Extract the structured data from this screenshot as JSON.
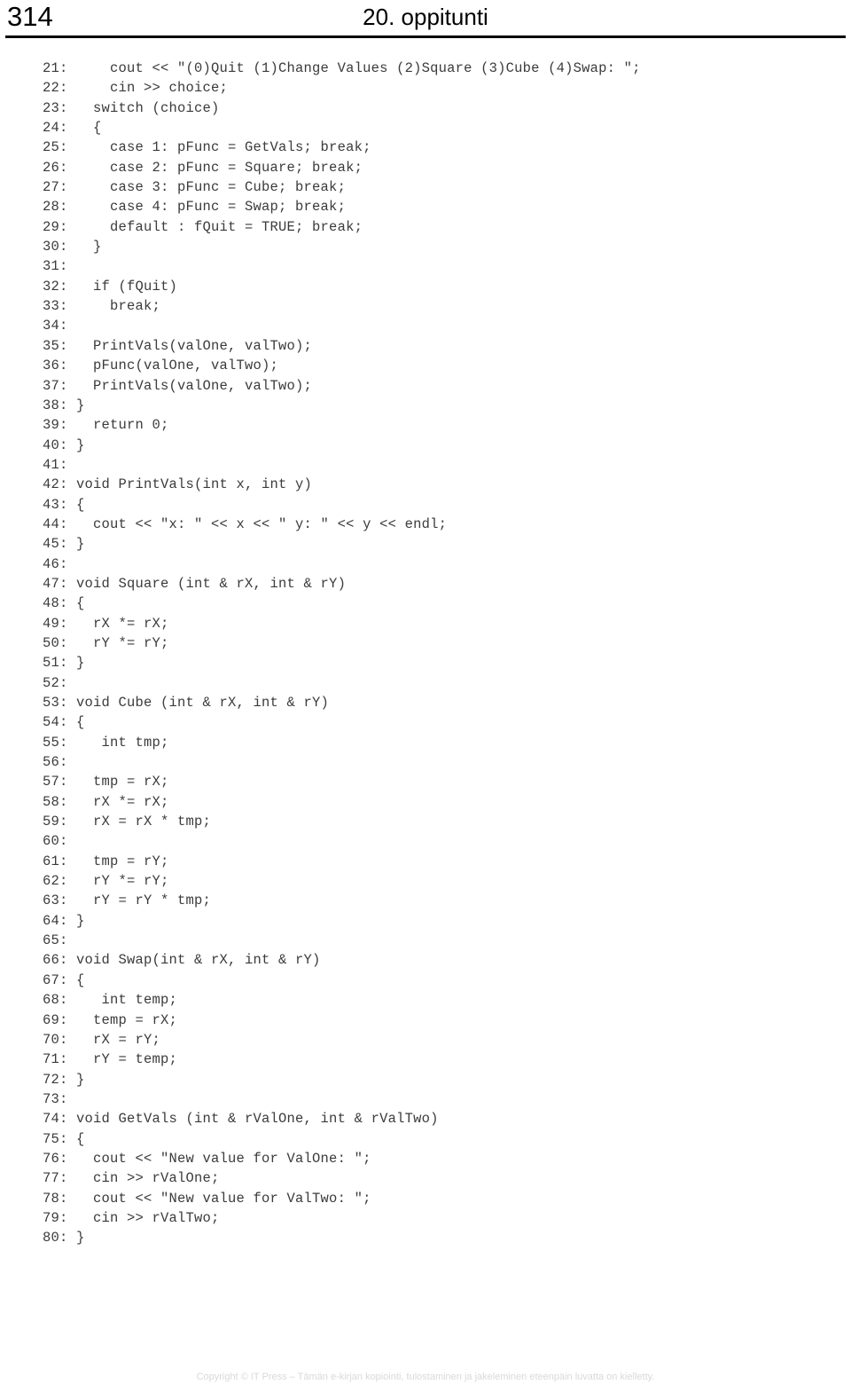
{
  "header": {
    "page_number": "314",
    "title": "20. oppitunti"
  },
  "code": {
    "language": "cpp",
    "first_line_number": 21,
    "last_line_number": 80,
    "lines": [
      {
        "n": "21:",
        "text": "    cout << \"(0)Quit (1)Change Values (2)Square (3)Cube (4)Swap: \";"
      },
      {
        "n": "22:",
        "text": "    cin >> choice;"
      },
      {
        "n": "23:",
        "text": "  switch (choice)"
      },
      {
        "n": "24:",
        "text": "  {"
      },
      {
        "n": "25:",
        "text": "    case 1: pFunc = GetVals; break;"
      },
      {
        "n": "26:",
        "text": "    case 2: pFunc = Square; break;"
      },
      {
        "n": "27:",
        "text": "    case 3: pFunc = Cube; break;"
      },
      {
        "n": "28:",
        "text": "    case 4: pFunc = Swap; break;"
      },
      {
        "n": "29:",
        "text": "    default : fQuit = TRUE; break;"
      },
      {
        "n": "30:",
        "text": "  }"
      },
      {
        "n": "31:",
        "text": ""
      },
      {
        "n": "32:",
        "text": "  if (fQuit)"
      },
      {
        "n": "33:",
        "text": "    break;"
      },
      {
        "n": "34:",
        "text": ""
      },
      {
        "n": "35:",
        "text": "  PrintVals(valOne, valTwo);"
      },
      {
        "n": "36:",
        "text": "  pFunc(valOne, valTwo);"
      },
      {
        "n": "37:",
        "text": "  PrintVals(valOne, valTwo);"
      },
      {
        "n": "38:",
        "text": "}"
      },
      {
        "n": "39:",
        "text": "  return 0;"
      },
      {
        "n": "40:",
        "text": "}"
      },
      {
        "n": "41:",
        "text": ""
      },
      {
        "n": "42:",
        "text": "void PrintVals(int x, int y)"
      },
      {
        "n": "43:",
        "text": "{"
      },
      {
        "n": "44:",
        "text": "  cout << \"x: \" << x << \" y: \" << y << endl;"
      },
      {
        "n": "45:",
        "text": "}"
      },
      {
        "n": "46:",
        "text": ""
      },
      {
        "n": "47:",
        "text": "void Square (int & rX, int & rY)"
      },
      {
        "n": "48:",
        "text": "{"
      },
      {
        "n": "49:",
        "text": "  rX *= rX;"
      },
      {
        "n": "50:",
        "text": "  rY *= rY;"
      },
      {
        "n": "51:",
        "text": "}"
      },
      {
        "n": "52:",
        "text": ""
      },
      {
        "n": "53:",
        "text": "void Cube (int & rX, int & rY)"
      },
      {
        "n": "54:",
        "text": "{"
      },
      {
        "n": "55:",
        "text": "   int tmp;"
      },
      {
        "n": "56:",
        "text": ""
      },
      {
        "n": "57:",
        "text": "  tmp = rX;"
      },
      {
        "n": "58:",
        "text": "  rX *= rX;"
      },
      {
        "n": "59:",
        "text": "  rX = rX * tmp;"
      },
      {
        "n": "60:",
        "text": ""
      },
      {
        "n": "61:",
        "text": "  tmp = rY;"
      },
      {
        "n": "62:",
        "text": "  rY *= rY;"
      },
      {
        "n": "63:",
        "text": "  rY = rY * tmp;"
      },
      {
        "n": "64:",
        "text": "}"
      },
      {
        "n": "65:",
        "text": ""
      },
      {
        "n": "66:",
        "text": "void Swap(int & rX, int & rY)"
      },
      {
        "n": "67:",
        "text": "{"
      },
      {
        "n": "68:",
        "text": "   int temp;"
      },
      {
        "n": "69:",
        "text": "  temp = rX;"
      },
      {
        "n": "70:",
        "text": "  rX = rY;"
      },
      {
        "n": "71:",
        "text": "  rY = temp;"
      },
      {
        "n": "72:",
        "text": "}"
      },
      {
        "n": "73:",
        "text": ""
      },
      {
        "n": "74:",
        "text": "void GetVals (int & rValOne, int & rValTwo)"
      },
      {
        "n": "75:",
        "text": "{"
      },
      {
        "n": "76:",
        "text": "  cout << \"New value for ValOne: \";"
      },
      {
        "n": "77:",
        "text": "  cin >> rValOne;"
      },
      {
        "n": "78:",
        "text": "  cout << \"New value for ValTwo: \";"
      },
      {
        "n": "79:",
        "text": "  cin >> rValTwo;"
      },
      {
        "n": "80:",
        "text": "}"
      }
    ]
  },
  "footer": {
    "copyright": "Copyright © IT Press – Tämän e-kirjan kopiointi, tulostaminen ja jakeleminen eteenpäin luvatta on kielletty."
  },
  "colors": {
    "page_background": "#ffffff",
    "text": "#000000",
    "code_text": "#3b3b3b",
    "rule": "#000000",
    "footer_text": "#d9d9d9"
  }
}
